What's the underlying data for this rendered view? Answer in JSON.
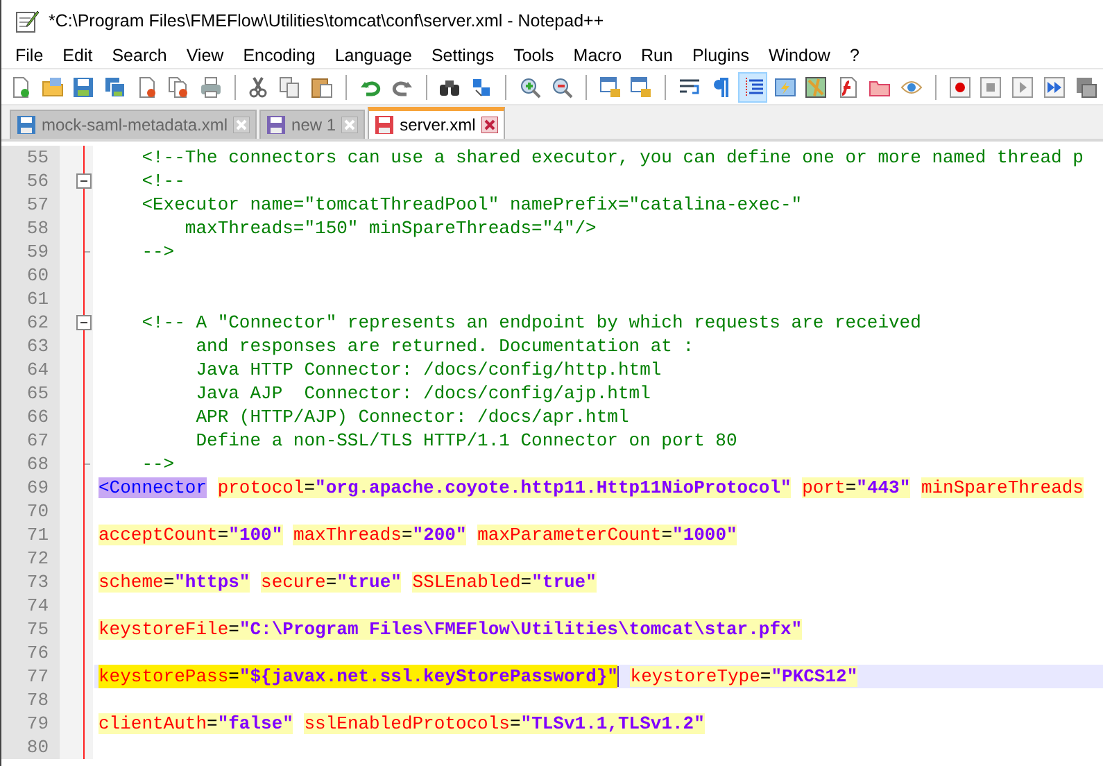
{
  "window": {
    "title": "*C:\\Program Files\\FMEFlow\\Utilities\\tomcat\\conf\\server.xml - Notepad++"
  },
  "menu": [
    {
      "label": "File"
    },
    {
      "label": "Edit"
    },
    {
      "label": "Search"
    },
    {
      "label": "View"
    },
    {
      "label": "Encoding"
    },
    {
      "label": "Language"
    },
    {
      "label": "Settings"
    },
    {
      "label": "Tools"
    },
    {
      "label": "Macro"
    },
    {
      "label": "Run"
    },
    {
      "label": "Plugins"
    },
    {
      "label": "Window"
    },
    {
      "label": "?"
    }
  ],
  "toolbar": [
    {
      "pressed": false
    },
    {
      "pressed": false
    },
    {
      "pressed": false
    },
    {
      "pressed": false
    },
    {
      "pressed": false
    },
    {
      "pressed": false
    },
    {
      "pressed": false
    },
    {
      "pressed": false
    },
    {
      "pressed": false
    },
    {
      "pressed": false
    },
    {
      "pressed": false
    },
    {
      "pressed": false
    },
    {
      "pressed": false
    },
    {
      "pressed": false
    },
    {
      "pressed": false
    },
    {
      "pressed": false
    },
    {
      "pressed": false
    },
    {
      "pressed": false
    },
    {
      "pressed": false
    },
    {
      "pressed": false
    },
    {
      "pressed": true
    },
    {
      "pressed": false
    },
    {
      "pressed": false
    },
    {
      "pressed": false
    },
    {
      "pressed": false
    },
    {
      "pressed": false
    },
    {
      "pressed": false
    },
    {
      "pressed": false
    },
    {
      "pressed": false
    },
    {
      "pressed": false
    },
    {
      "pressed": false
    }
  ],
  "tabs": [
    {
      "label": "mock-saml-metadata.xml",
      "selected": false,
      "color": "#3c7fc4"
    },
    {
      "label": "new 1",
      "selected": false,
      "color": "#7a64b4"
    },
    {
      "label": "server.xml",
      "selected": true,
      "color": "#e0424a"
    }
  ],
  "editor": {
    "lines": [
      {
        "number": "55",
        "fold_open": false,
        "fold_end": false,
        "current": false,
        "segments": [
          {
            "kind": "comment",
            "text": "    <!--The connectors can use a shared executor, you can define one or more named thread p"
          }
        ]
      },
      {
        "number": "56",
        "fold_open": true,
        "fold_end": false,
        "current": false,
        "segments": [
          {
            "kind": "comment",
            "text": "    <!--"
          }
        ]
      },
      {
        "number": "57",
        "fold_open": false,
        "fold_end": false,
        "current": false,
        "segments": [
          {
            "kind": "comment",
            "text": "    <Executor name=\"tomcatThreadPool\" namePrefix=\"catalina-exec-\""
          }
        ]
      },
      {
        "number": "58",
        "fold_open": false,
        "fold_end": false,
        "current": false,
        "segments": [
          {
            "kind": "comment",
            "text": "        maxThreads=\"150\" minSpareThreads=\"4\"/>"
          }
        ]
      },
      {
        "number": "59",
        "fold_open": false,
        "fold_end": true,
        "current": false,
        "segments": [
          {
            "kind": "comment",
            "text": "    -->"
          }
        ]
      },
      {
        "number": "60",
        "fold_open": false,
        "fold_end": false,
        "current": false
      },
      {
        "number": "61",
        "fold_open": false,
        "fold_end": false,
        "current": false
      },
      {
        "number": "62",
        "fold_open": true,
        "fold_end": false,
        "current": false,
        "segments": [
          {
            "kind": "comment",
            "text": "    <!-- A \"Connector\" represents an endpoint by which requests are received"
          }
        ]
      },
      {
        "number": "63",
        "fold_open": false,
        "fold_end": false,
        "current": false,
        "segments": [
          {
            "kind": "comment",
            "text": "         and responses are returned. Documentation at :"
          }
        ]
      },
      {
        "number": "64",
        "fold_open": false,
        "fold_end": false,
        "current": false,
        "segments": [
          {
            "kind": "comment",
            "text": "         Java HTTP Connector: /docs/config/http.html"
          }
        ]
      },
      {
        "number": "65",
        "fold_open": false,
        "fold_end": false,
        "current": false,
        "segments": [
          {
            "kind": "comment",
            "text": "         Java AJP  Connector: /docs/config/ajp.html"
          }
        ]
      },
      {
        "number": "66",
        "fold_open": false,
        "fold_end": false,
        "current": false,
        "segments": [
          {
            "kind": "comment",
            "text": "         APR (HTTP/AJP) Connector: /docs/apr.html"
          }
        ]
      },
      {
        "number": "67",
        "fold_open": false,
        "fold_end": false,
        "current": false,
        "segments": [
          {
            "kind": "comment",
            "text": "         Define a non-SSL/TLS HTTP/1.1 Connector on port 80"
          }
        ]
      },
      {
        "number": "68",
        "fold_open": false,
        "fold_end": true,
        "current": false,
        "segments": [
          {
            "kind": "comment",
            "text": "    -->"
          }
        ]
      },
      {
        "number": "69",
        "fold_open": false,
        "fold_end": false,
        "current": false,
        "segments": [
          {
            "kind": "tag",
            "text": "<Connector",
            "color": "#c8a8f4"
          },
          {
            "kind": "pair",
            "name": "protocol",
            "op": "=",
            "value": "\"org.apache.coyote.http11.Http11NioProtocol\"",
            "color": "#fdfdb0",
            "caret": false
          },
          {
            "kind": "pair",
            "name": "port",
            "op": "=",
            "value": "\"443\"",
            "color": "#fdfdb0",
            "caret": false
          },
          {
            "kind": "pair",
            "name": "minSpareThreads",
            "color": "#fdfdb0",
            "caret": false
          }
        ]
      },
      {
        "number": "70",
        "fold_open": false,
        "fold_end": false,
        "current": false
      },
      {
        "number": "71",
        "fold_open": false,
        "fold_end": false,
        "current": false,
        "segments": [
          {
            "kind": "pair",
            "name": "acceptCount",
            "op": "=",
            "value": "\"100\"",
            "color": "#fdfdb0",
            "caret": false
          },
          {
            "kind": "pair",
            "name": "maxThreads",
            "op": "=",
            "value": "\"200\"",
            "color": "#fdfdb0",
            "caret": false
          },
          {
            "kind": "pair",
            "name": "maxParameterCount",
            "op": "=",
            "value": "\"1000\"",
            "color": "#fdfdb0",
            "caret": false
          }
        ]
      },
      {
        "number": "72",
        "fold_open": false,
        "fold_end": false,
        "current": false
      },
      {
        "number": "73",
        "fold_open": false,
        "fold_end": false,
        "current": false,
        "segments": [
          {
            "kind": "pair",
            "name": "scheme",
            "op": "=",
            "value": "\"https\"",
            "color": "#fdfdb0",
            "caret": false
          },
          {
            "kind": "pair",
            "name": "secure",
            "op": "=",
            "value": "\"true\"",
            "color": "#fdfdb0",
            "caret": false
          },
          {
            "kind": "pair",
            "name": "SSLEnabled",
            "op": "=",
            "value": "\"true\"",
            "color": "#fdfdb0",
            "caret": false
          }
        ]
      },
      {
        "number": "74",
        "fold_open": false,
        "fold_end": false,
        "current": false
      },
      {
        "number": "75",
        "fold_open": false,
        "fold_end": false,
        "current": false,
        "segments": [
          {
            "kind": "pair",
            "name": "keystoreFile",
            "op": "=",
            "value": "\"C:\\Program Files\\FMEFlow\\Utilities\\tomcat\\star.pfx\"",
            "color": "#fdfdb0",
            "caret": false
          }
        ]
      },
      {
        "number": "76",
        "fold_open": false,
        "fold_end": false,
        "current": false
      },
      {
        "number": "77",
        "fold_open": false,
        "fold_end": false,
        "current": true,
        "segments": [
          {
            "kind": "pair",
            "name": "keystorePass",
            "op": "=",
            "value": "\"${javax.net.ssl.keyStorePassword}\"",
            "color": "#ffee00",
            "caret": true
          },
          {
            "kind": "pair",
            "name": "keystoreType",
            "op": "=",
            "value": "\"PKCS12\"",
            "color": "#fdfdb0",
            "caret": false
          }
        ]
      },
      {
        "number": "78",
        "fold_open": false,
        "fold_end": false,
        "current": false
      },
      {
        "number": "79",
        "fold_open": false,
        "fold_end": false,
        "current": false,
        "segments": [
          {
            "kind": "pair",
            "name": "clientAuth",
            "op": "=",
            "value": "\"false\"",
            "color": "#fdfdb0",
            "caret": false
          },
          {
            "kind": "pair",
            "name": "sslEnabledProtocols",
            "op": "=",
            "value": "\"TLSv1.1,TLSv1.2\"",
            "color": "#fdfdb0",
            "caret": false
          }
        ]
      },
      {
        "number": "80",
        "fold_open": false,
        "fold_end": false,
        "current": false
      }
    ]
  }
}
